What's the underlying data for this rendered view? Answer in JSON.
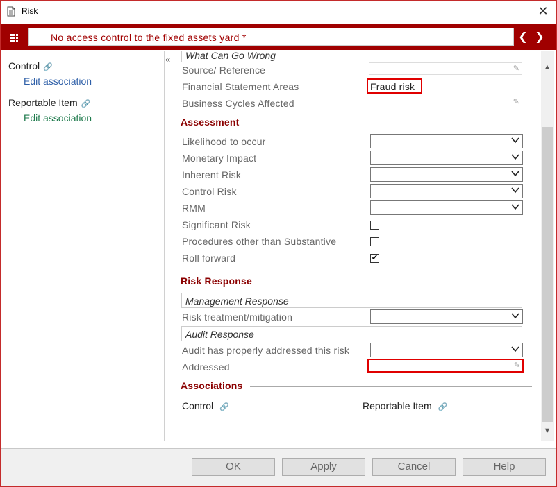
{
  "window": {
    "title": "Risk",
    "close_glyph": "✕"
  },
  "header": {
    "record_title": "No access control to the fixed assets yard *",
    "prev_glyph": "❮",
    "next_glyph": "❯"
  },
  "sidebar": {
    "collapse_glyph": "«",
    "items": [
      {
        "label": "Control",
        "link": "Edit association"
      },
      {
        "label": "Reportable Item",
        "link": "Edit association"
      }
    ]
  },
  "form": {
    "what_can_go_wrong": "What Can Go Wrong",
    "source_reference": "Source/ Reference",
    "financial_statement_areas": {
      "label": "Financial Statement Areas",
      "value": "Fraud risk"
    },
    "business_cycles_affected": "Business Cycles Affected",
    "assessment": {
      "heading": "Assessment",
      "likelihood": "Likelihood to occur",
      "monetary_impact": "Monetary Impact",
      "inherent_risk": "Inherent Risk",
      "control_risk": "Control Risk",
      "rmm": "RMM",
      "significant_risk": "Significant Risk",
      "procedures_other": "Procedures other than Substantive",
      "roll_forward": "Roll forward"
    },
    "risk_response": {
      "heading": "Risk Response",
      "management_response": "Management Response",
      "risk_treatment": "Risk treatment/mitigation",
      "audit_response": "Audit Response",
      "audit_addressed": "Audit has properly addressed this risk",
      "addressed": "Addressed"
    },
    "associations": {
      "heading": "Associations",
      "control": "Control",
      "reportable_item": "Reportable Item"
    }
  },
  "checkboxes": {
    "significant_risk": false,
    "procedures_other": false,
    "roll_forward": true
  },
  "scrollbar": {
    "up_glyph": "▲",
    "down_glyph": "▼"
  },
  "footer": {
    "ok": "OK",
    "apply": "Apply",
    "cancel": "Cancel",
    "help": "Help"
  },
  "colors": {
    "brand": "#a00000",
    "section": "#8b0000",
    "link_blue": "#2e5fa8",
    "link_green": "#1e7a4c",
    "highlight": "#e00000"
  }
}
